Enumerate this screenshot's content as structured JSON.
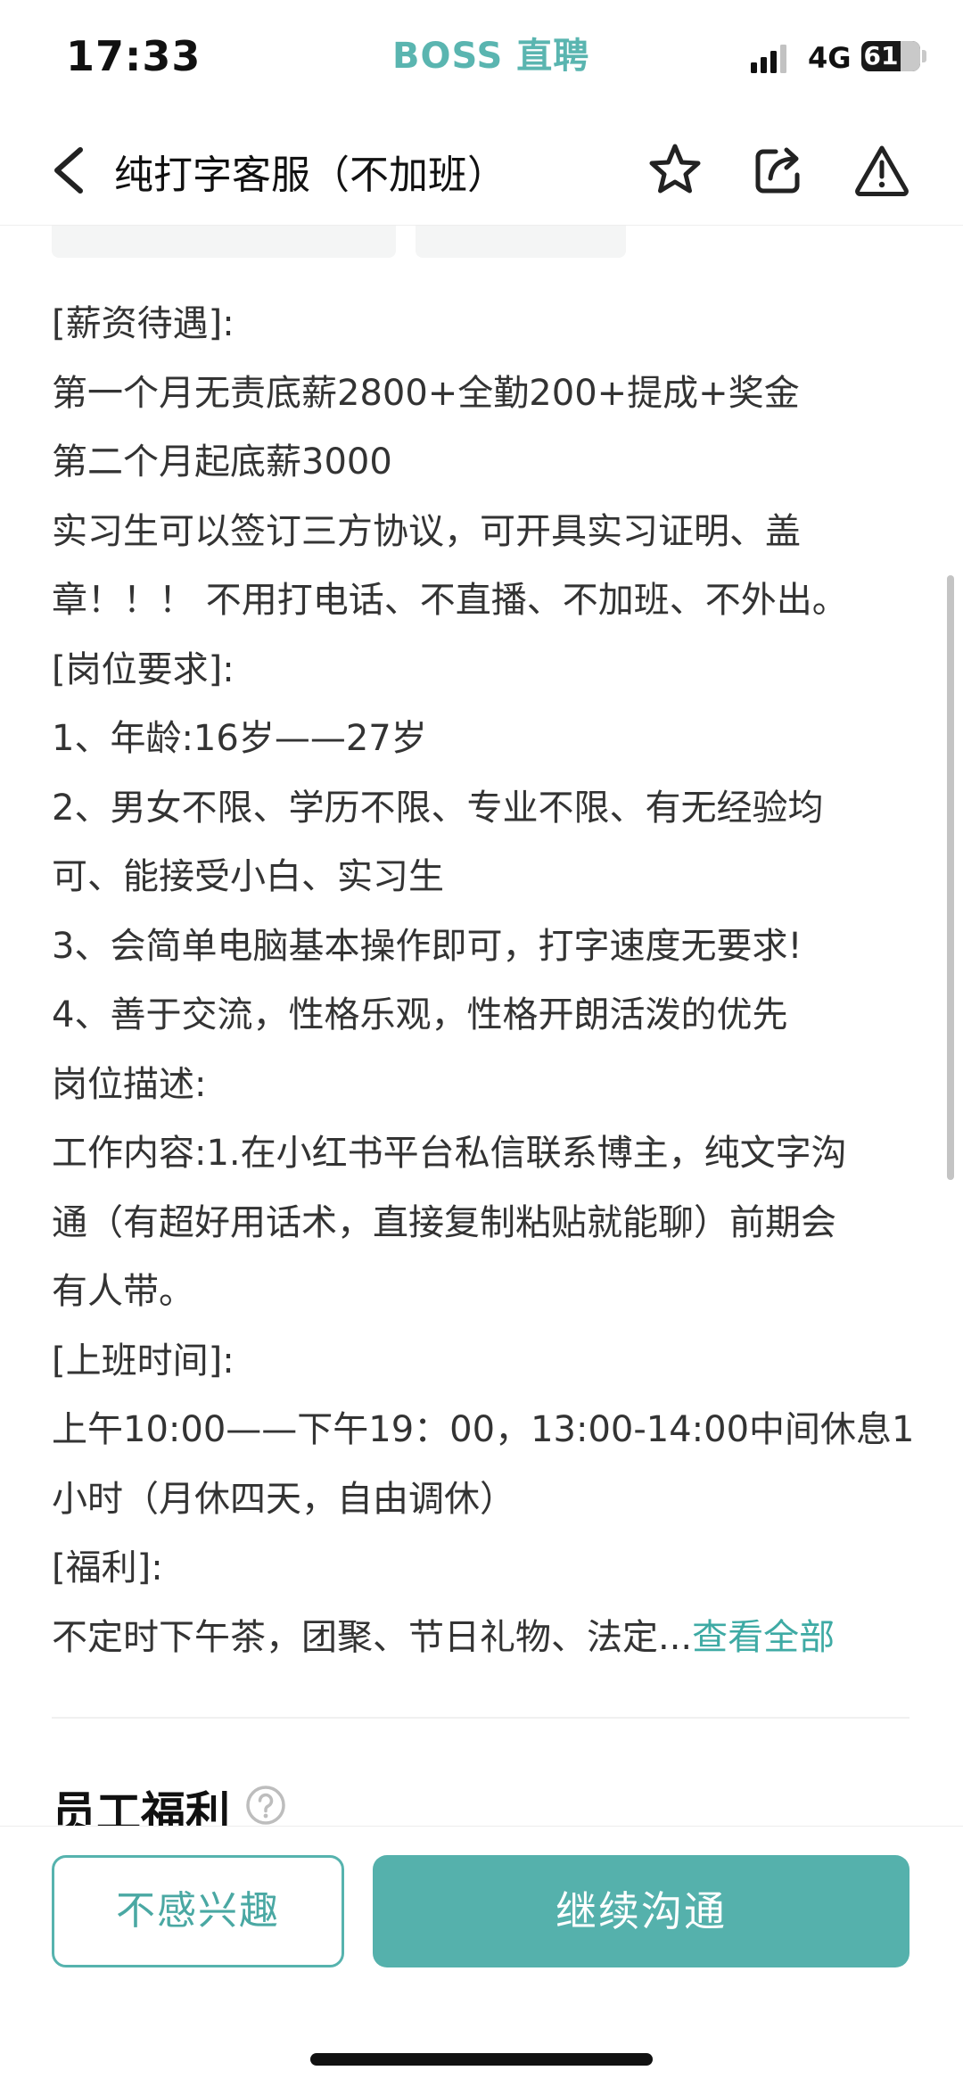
{
  "status_bar": {
    "time": "17:33",
    "brand": "BOSS 直聘",
    "network": "4G",
    "battery": "61",
    "icons": [
      "signal-icon",
      "battery-icon"
    ]
  },
  "nav": {
    "title": "纯打字客服（不加班）",
    "icons": [
      "back-arrow-icon",
      "star-icon",
      "share-icon",
      "warning-icon"
    ]
  },
  "description": {
    "lines": [
      "[薪资待遇]:",
      "第一个月无责底薪2800+全勤200+提成+奖金",
      "第二个月起底薪3000",
      "实习生可以签订三方协议，可开具实习证明、盖",
      "章！！！ 不用打电话、不直播、不加班、不外出。",
      "[岗位要求]:",
      "1、年龄:16岁——27岁",
      "2、男女不限、学历不限、专业不限、有无经验均",
      "可、能接受小白、实习生",
      "3、会简单电脑基本操作即可，打字速度无要求!",
      "4、善于交流，性格乐观，性格开朗活泼的优先",
      "岗位描述:",
      "工作内容:1.在小红书平台私信联系博主，纯文字沟",
      "通（有超好用话术，直接复制粘贴就能聊）前期会",
      "有人带。",
      "[上班时间]:",
      "上午10:00——下午19：00，13:00-14:00中间休息1",
      "小时（月休四天，自由调休）",
      "[福利]:"
    ],
    "last_line": "不定时下午茶，团聚、节日礼物、法定...",
    "more_link": "查看全部"
  },
  "benefits": {
    "title": "员工福利",
    "help_icon": "help-circle-icon"
  },
  "bottom": {
    "not_interested": "不感兴趣",
    "continue_chat": "继续沟通"
  },
  "colors": {
    "accent": "#55b1ac",
    "brand": "#5ab5b0",
    "link": "#3eaaa4"
  }
}
